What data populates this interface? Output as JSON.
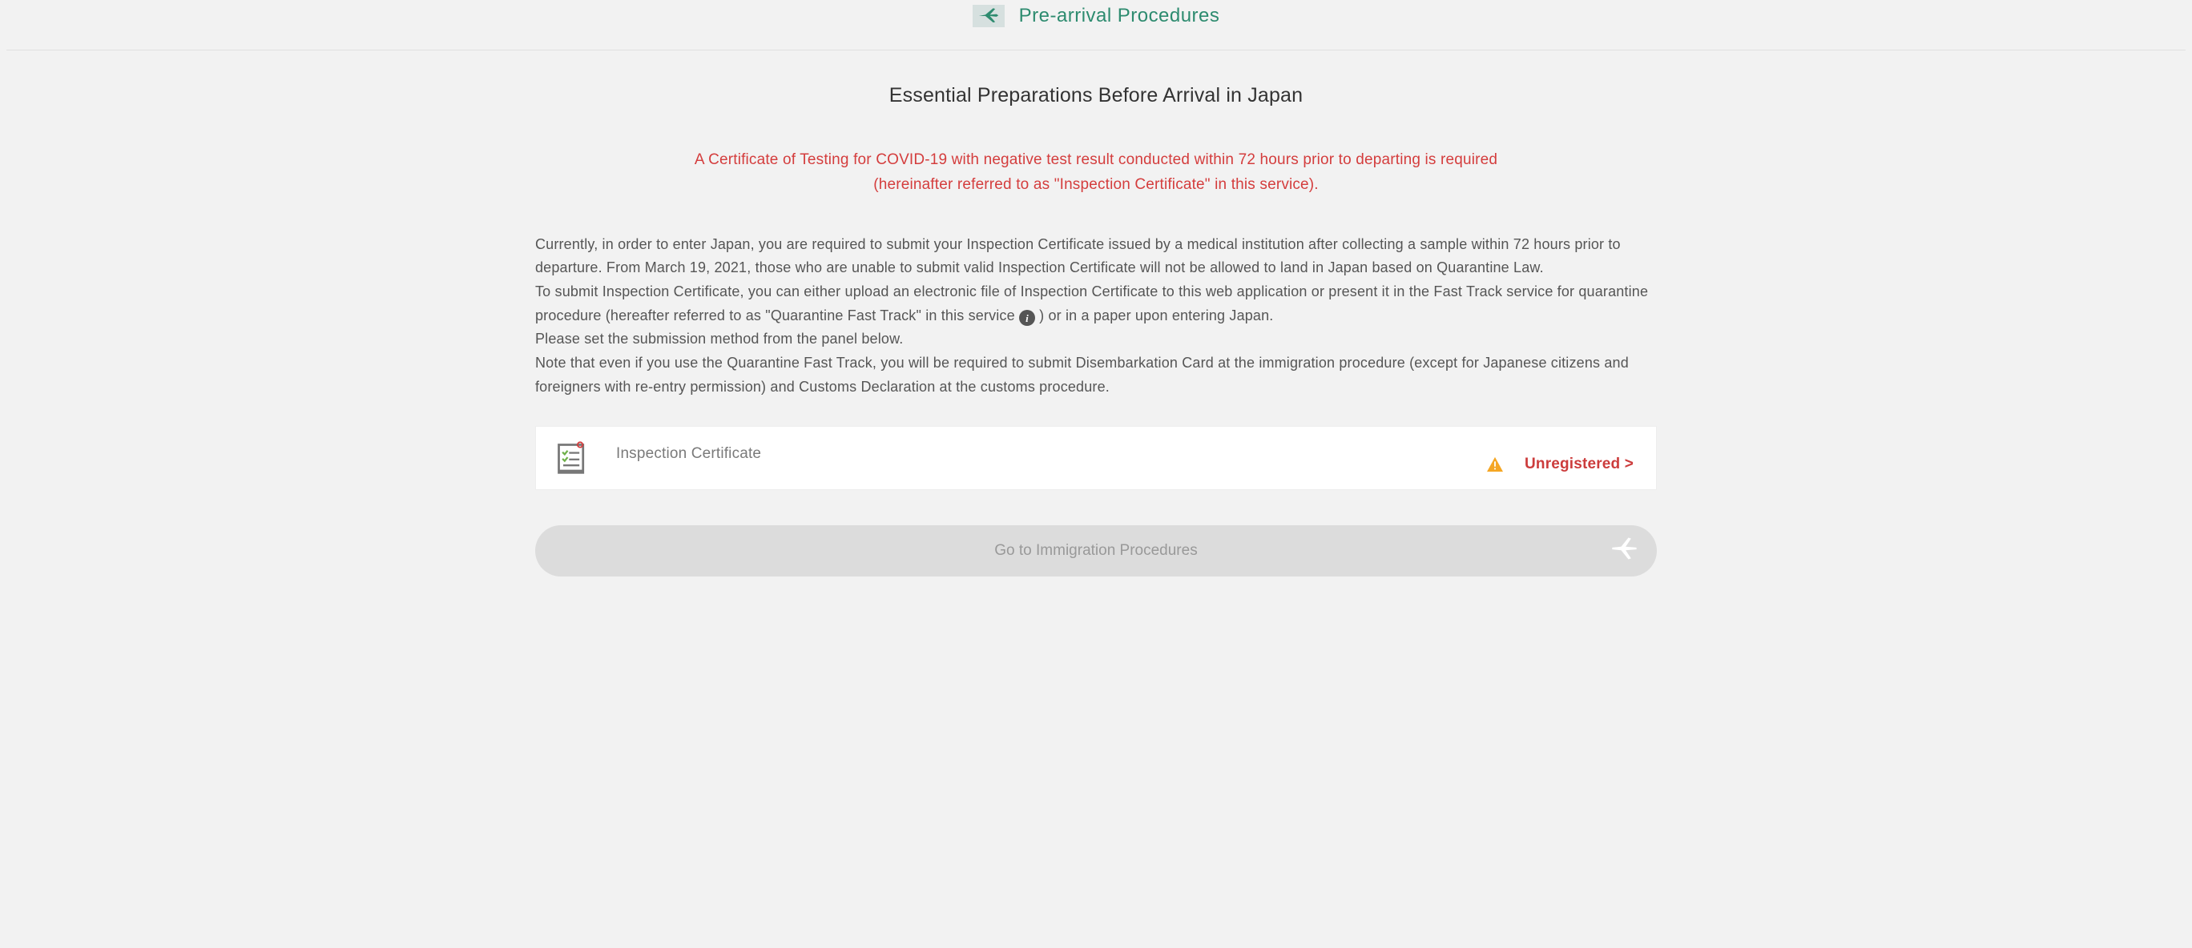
{
  "header": {
    "title": "Pre-arrival Procedures"
  },
  "main": {
    "title": "Essential Preparations Before Arrival in Japan",
    "notice_line1": "A Certificate of Testing for COVID-19 with negative test result conducted within 72 hours prior to departing is required",
    "notice_line2": "(hereinafter referred to as \"Inspection Certificate\" in this service).",
    "para1": "Currently, in order to enter Japan, you are required to submit your Inspection Certificate issued by a medical institution after collecting a sample within 72 hours prior to departure. From March 19, 2021, those who are unable to submit valid Inspection Certificate will not be allowed to land in Japan based on Quarantine Law.",
    "para2_a": "To submit Inspection Certificate, you can either upload an electronic file of Inspection Certificate to this web application or present it in the Fast Track service for quarantine procedure (hereafter referred to as \"Quarantine Fast Track\" in this service ",
    "para2_b": " ) or in a paper upon entering Japan.",
    "para3": "Please set the submission method from the panel below.",
    "para4": "Note that even if you use the Quarantine Fast Track, you will be required to submit Disembarkation Card at the immigration procedure (except for Japanese citizens and foreigners with re-entry permission) and Customs Declaration at the customs procedure."
  },
  "card": {
    "title": "Inspection Certificate",
    "status": "Unregistered >"
  },
  "cta": {
    "label": "Go to Immigration Procedures"
  }
}
